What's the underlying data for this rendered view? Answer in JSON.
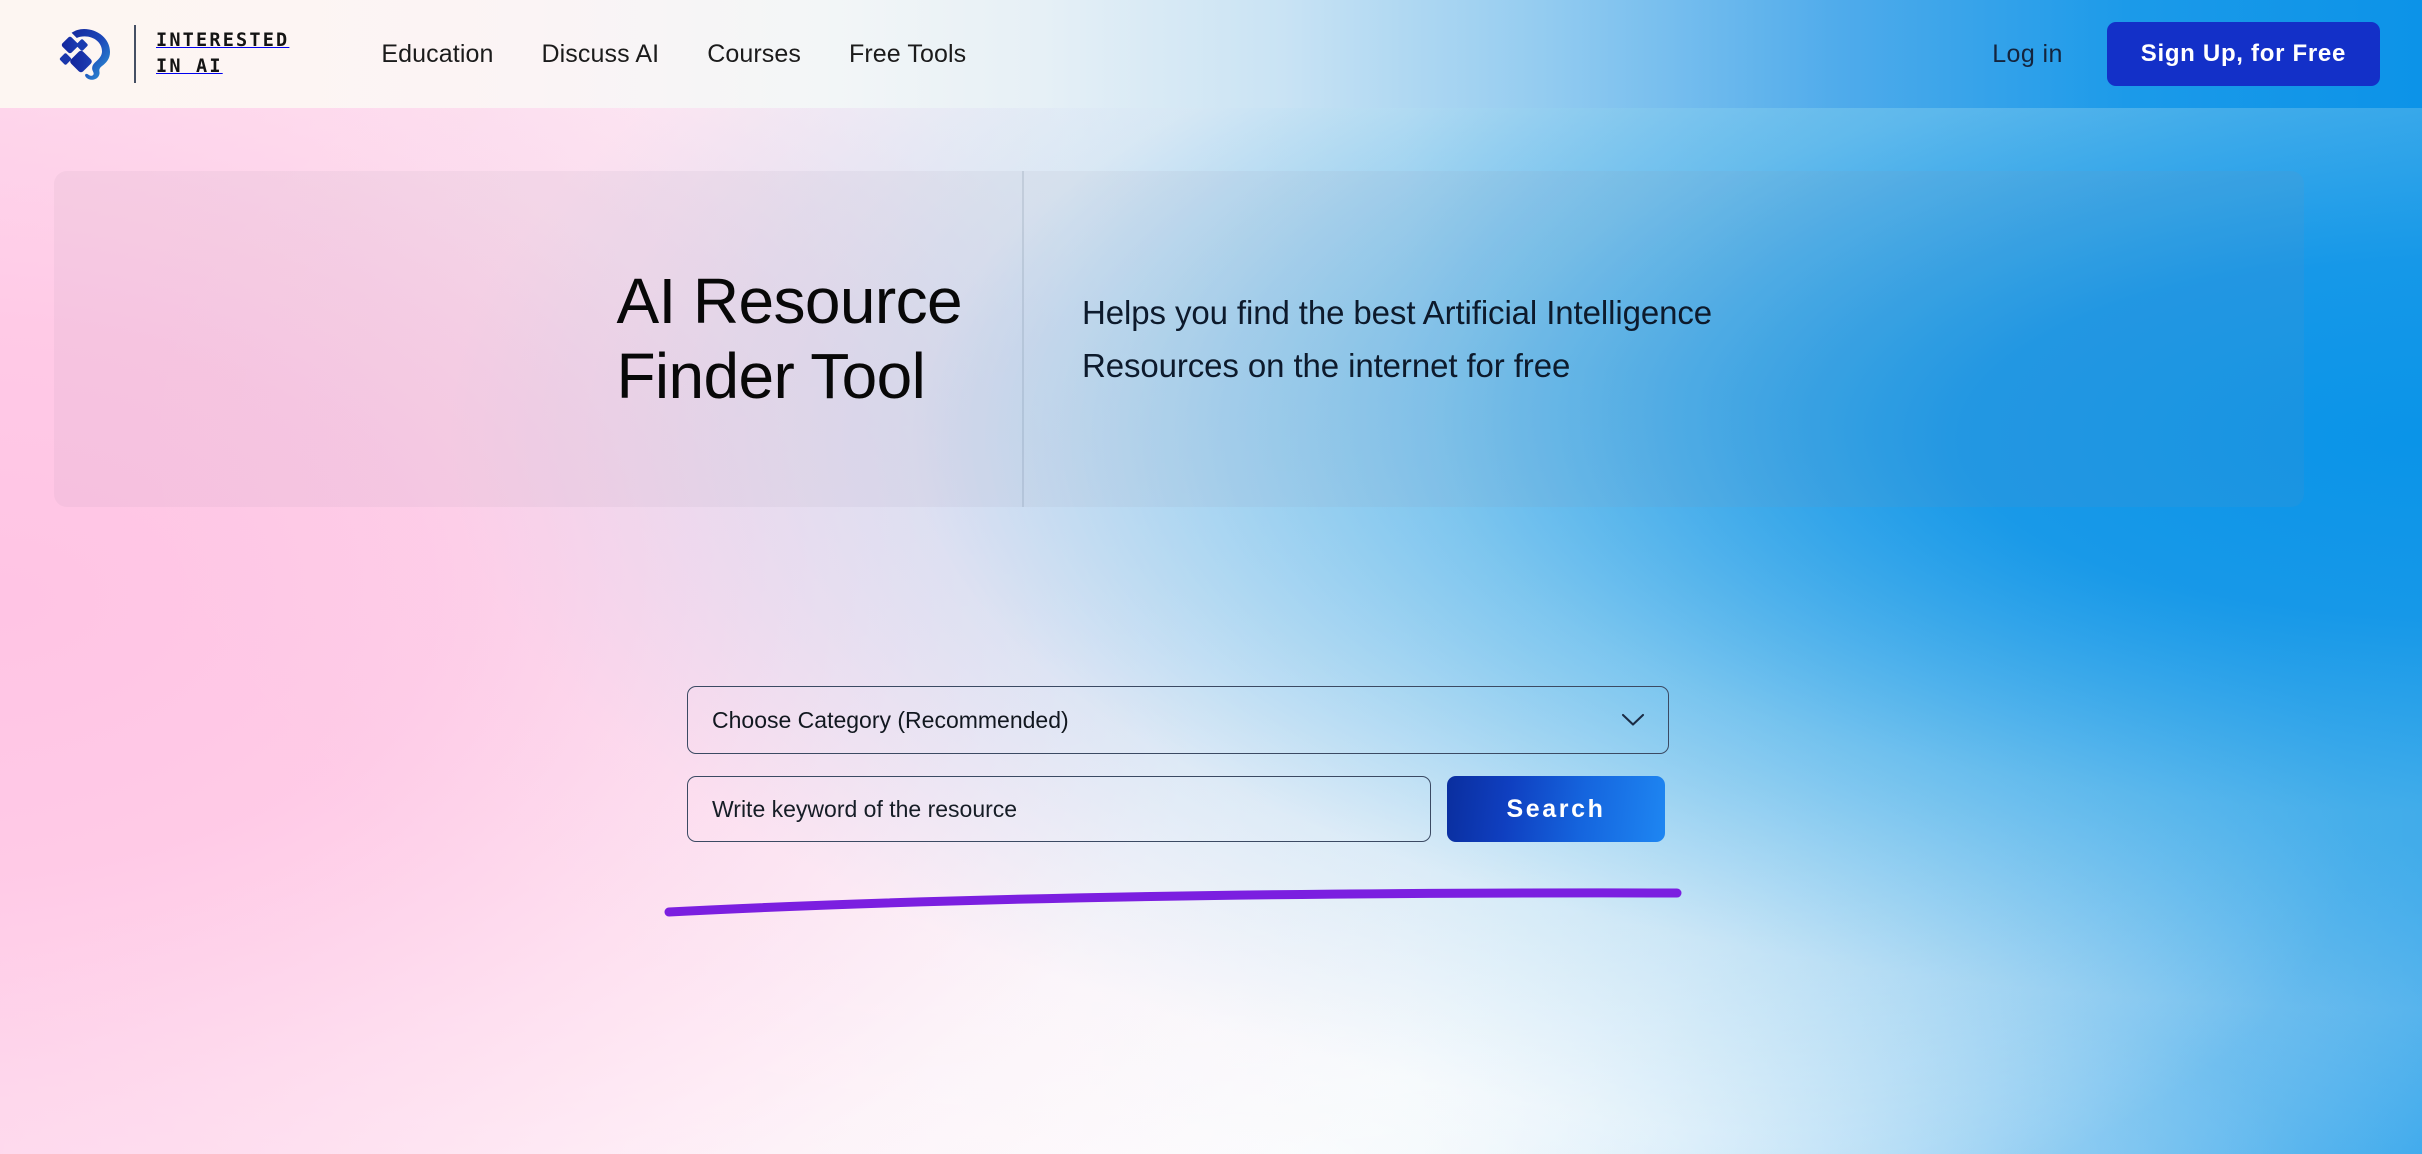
{
  "header": {
    "brand": {
      "logo_icon": "ai-head-logo-icon",
      "wordmark": "INTERESTED\nIN AI"
    },
    "nav": [
      {
        "label": "Education"
      },
      {
        "label": "Discuss AI"
      },
      {
        "label": "Courses"
      },
      {
        "label": "Free Tools"
      }
    ],
    "login_label": "Log in",
    "signup_label": "Sign Up, for Free"
  },
  "hero": {
    "title": "AI Resource\nFinder Tool",
    "subtitle": "Helps you find the best Artificial Intelligence\nResources on the internet for free"
  },
  "search": {
    "category_selected": "Choose Category (Recommended)",
    "category_options": [
      "Choose Category (Recommended)"
    ],
    "chevron_icon": "chevron-down-icon",
    "keyword_placeholder": "Write keyword of the resource",
    "keyword_value": "",
    "search_button_label": "Search"
  },
  "decor": {
    "underline_color": "#7b1fe0"
  },
  "colors": {
    "signup_button_bg": "#1330c8",
    "search_button_gradient_start": "#0a2e9e",
    "search_button_gradient_end": "#1e86f2",
    "header_gradient_start": "#fdf6f2",
    "header_gradient_end": "#0c93e8",
    "accent_blue": "#0a93e8",
    "accent_pink": "#ffd3ea",
    "text_dark": "#080808"
  }
}
